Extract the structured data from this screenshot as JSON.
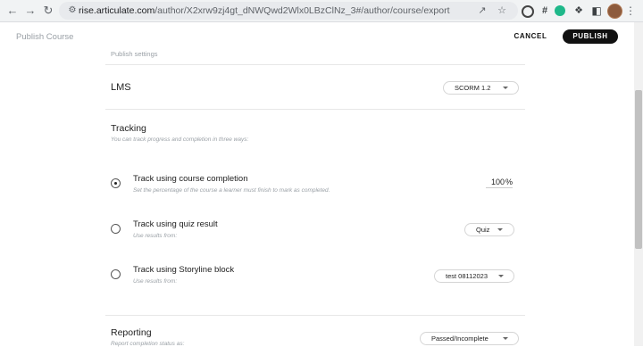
{
  "browser": {
    "url_host": "rise.articulate.com",
    "url_path": "/author/X2xrw9zj4gt_dNWQwd2Wlx0LBzClNz_3#/author/course/export",
    "back_icon": "arrow-left-icon",
    "forward_icon": "arrow-right-icon",
    "reload_icon": "reload-icon",
    "ext_hash": "#"
  },
  "header": {
    "title": "Publish Course",
    "cancel_label": "CANCEL",
    "publish_label": "PUBLISH"
  },
  "settings": {
    "section_label": "Publish settings",
    "lms_label": "LMS",
    "lms_value": "SCORM 1.2",
    "tracking_title": "Tracking",
    "tracking_desc": "You can track progress and completion in three ways:",
    "options": [
      {
        "label": "Track using course completion",
        "desc": "Set the percentage of the course a learner must finish to mark as completed.",
        "selected": true,
        "value": "100",
        "unit": "%"
      },
      {
        "label": "Track using quiz result",
        "desc": "Use results from:",
        "selected": false,
        "value": "Quiz"
      },
      {
        "label": "Track using Storyline block",
        "desc": "Use results from:",
        "selected": false,
        "value": "test 08112023"
      }
    ],
    "reporting_title": "Reporting",
    "reporting_desc": "Report completion status as:",
    "reporting_value": "Passed/Incomplete"
  },
  "colors": {
    "publish_bg": "#111111",
    "muted_text": "#9aa0a6"
  }
}
